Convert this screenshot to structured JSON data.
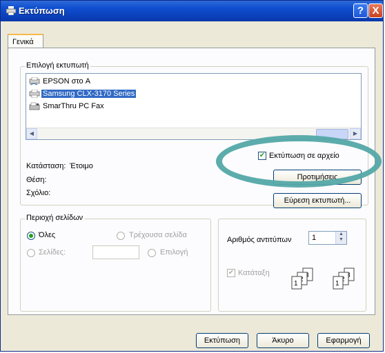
{
  "window": {
    "title": "Εκτύπωση",
    "help_button": "?",
    "close_button": "X"
  },
  "tabs": [
    {
      "label": "Γενικά",
      "selected": true
    }
  ],
  "printer_selection": {
    "legend": "Επιλογή εκτυπωτή",
    "printers": [
      {
        "name": "EPSON στο A",
        "icon": "network-printer-icon",
        "selected": false
      },
      {
        "name": "Samsung CLX-3170 Series",
        "icon": "printer-icon",
        "selected": true
      },
      {
        "name": "SmarThru PC Fax",
        "icon": "fax-icon",
        "selected": false
      }
    ],
    "status_label": "Κατάσταση:",
    "status_value": "Έτοιμο",
    "location_label": "Θέση:",
    "location_value": "",
    "comment_label": "Σχόλιο:",
    "comment_value": "",
    "print_to_file_label": "Εκτύπωση σε αρχείο",
    "print_to_file_checked": true,
    "preferences_button": "Προτιμήσεις",
    "find_printer_button": "Εύρεση εκτυπωτή..."
  },
  "page_range": {
    "legend": "Περιοχή σελίδων",
    "all_label": "Όλες",
    "current_page_label": "Τρέχουσα σελίδα",
    "pages_label": "Σελίδες:",
    "pages_value": "",
    "selection_label": "Επιλογή",
    "selected_option": "all"
  },
  "copies": {
    "count_label": "Αριθμός αντιτύπων",
    "count_value": "1",
    "collate_label": "Κατάταξη",
    "collate_checked": true,
    "collate_enabled": false
  },
  "buttons": {
    "print": "Εκτύπωση",
    "cancel": "Άκυρο",
    "apply": "Εφαρμογή"
  },
  "colors": {
    "titlebar": "#0a3fb8",
    "selection": "#316ac5",
    "highlight_ring": "#54a8a8",
    "check_green": "#21a121"
  }
}
